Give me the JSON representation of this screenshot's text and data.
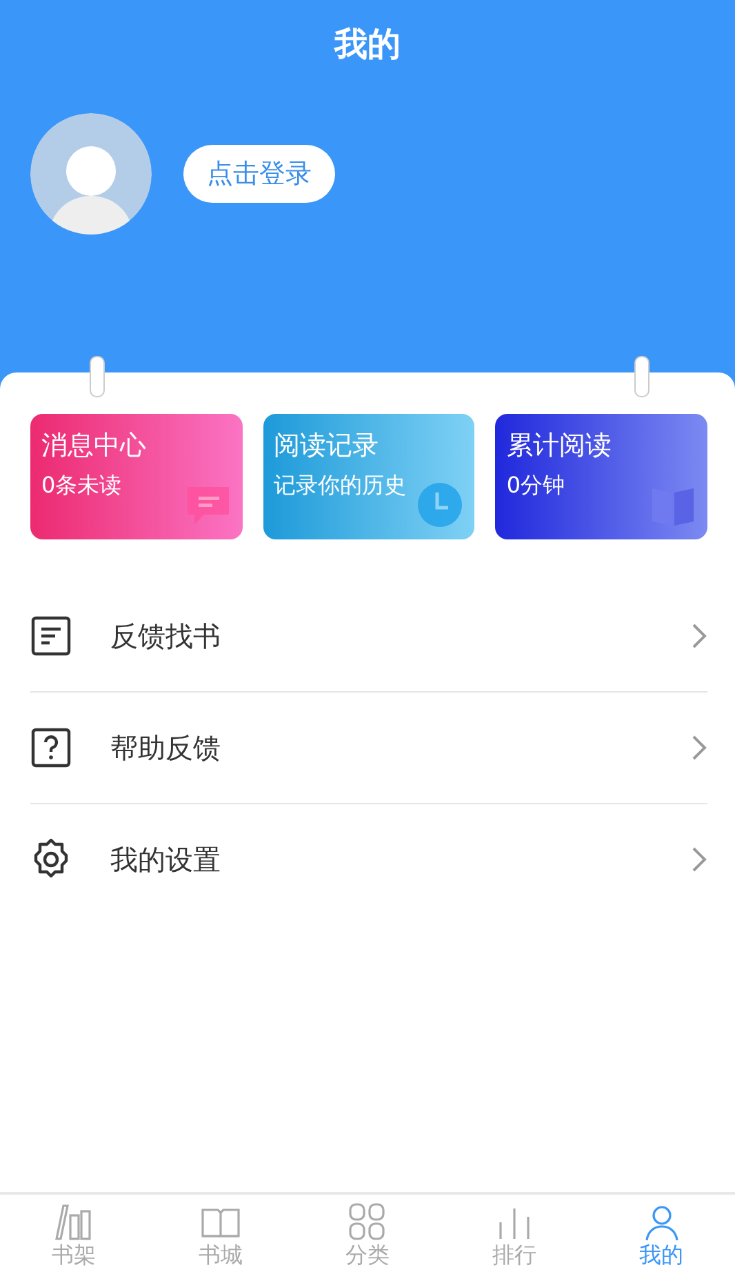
{
  "header": {
    "title": "我的",
    "login_button": "点击登录"
  },
  "cards": [
    {
      "kind": "message",
      "title": "消息中心",
      "subtitle": "0条未读"
    },
    {
      "kind": "history",
      "title": "阅读记录",
      "subtitle": "记录你的历史"
    },
    {
      "kind": "total",
      "title": "累计阅读",
      "subtitle": "0分钟"
    }
  ],
  "menu": [
    {
      "kind": "feedback",
      "label": "反馈找书"
    },
    {
      "kind": "help",
      "label": "帮助反馈"
    },
    {
      "kind": "settings",
      "label": "我的设置"
    }
  ],
  "tabs": [
    {
      "kind": "shelf",
      "label": "书架",
      "selected": false
    },
    {
      "kind": "store",
      "label": "书城",
      "selected": false
    },
    {
      "kind": "category",
      "label": "分类",
      "selected": false
    },
    {
      "kind": "rank",
      "label": "排行",
      "selected": false
    },
    {
      "kind": "me",
      "label": "我的",
      "selected": true
    }
  ]
}
